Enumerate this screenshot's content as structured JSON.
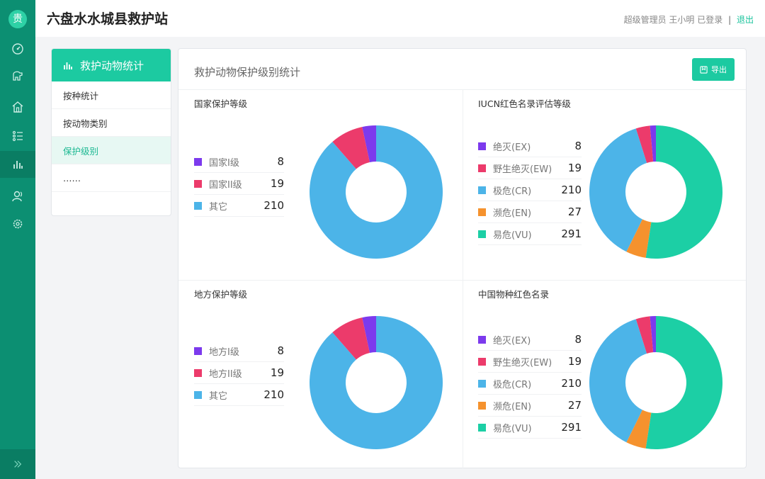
{
  "app": {
    "logo_char": "贵",
    "title": "六盘水水城县救护站"
  },
  "user": {
    "role": "超级管理员",
    "name": "王小明",
    "status": "已登录",
    "separator": "|",
    "logout": "退出"
  },
  "rail_icons": [
    "dashboard-icon",
    "animal-icon",
    "home-icon",
    "list-icon",
    "bar-chart-icon",
    "user-icon",
    "settings-icon"
  ],
  "subnav": {
    "header": "救护动物统计",
    "items": [
      {
        "label": "按种统计"
      },
      {
        "label": "按动物类别"
      },
      {
        "label": "保护级别"
      },
      {
        "label": "……"
      }
    ]
  },
  "panel": {
    "title": "救护动物保护级别统计",
    "export_label": "导出"
  },
  "colors": {
    "brand": "#1ccaa1",
    "rail": "#0c8f72",
    "purple": "#7c3aed",
    "pink": "#ec3b6b",
    "blue": "#4cb4e8",
    "orange": "#f5922e",
    "teal": "#1ccfa5"
  },
  "chart_data": [
    {
      "type": "pie",
      "title": "国家保护等级",
      "categories": [
        "国家I级",
        "国家II级",
        "其它"
      ],
      "values": [
        8,
        19,
        210
      ],
      "colors": [
        "#7c3aed",
        "#ec3b6b",
        "#4cb4e8"
      ]
    },
    {
      "type": "pie",
      "title": "IUCN红色名录评估等级",
      "categories": [
        "绝灭(EX)",
        "野生绝灭(EW)",
        "极危(CR)",
        "濒危(EN)",
        "易危(VU)"
      ],
      "values": [
        8,
        19,
        210,
        27,
        291
      ],
      "colors": [
        "#7c3aed",
        "#ec3b6b",
        "#4cb4e8",
        "#f5922e",
        "#1ccfa5"
      ]
    },
    {
      "type": "pie",
      "title": "地方保护等级",
      "categories": [
        "地方I级",
        "地方II级",
        "其它"
      ],
      "values": [
        8,
        19,
        210
      ],
      "colors": [
        "#7c3aed",
        "#ec3b6b",
        "#4cb4e8"
      ]
    },
    {
      "type": "pie",
      "title": "中国物种红色名录",
      "categories": [
        "绝灭(EX)",
        "野生绝灭(EW)",
        "极危(CR)",
        "濒危(EN)",
        "易危(VU)"
      ],
      "values": [
        8,
        19,
        210,
        27,
        291
      ],
      "colors": [
        "#7c3aed",
        "#ec3b6b",
        "#4cb4e8",
        "#f5922e",
        "#1ccfa5"
      ]
    }
  ]
}
